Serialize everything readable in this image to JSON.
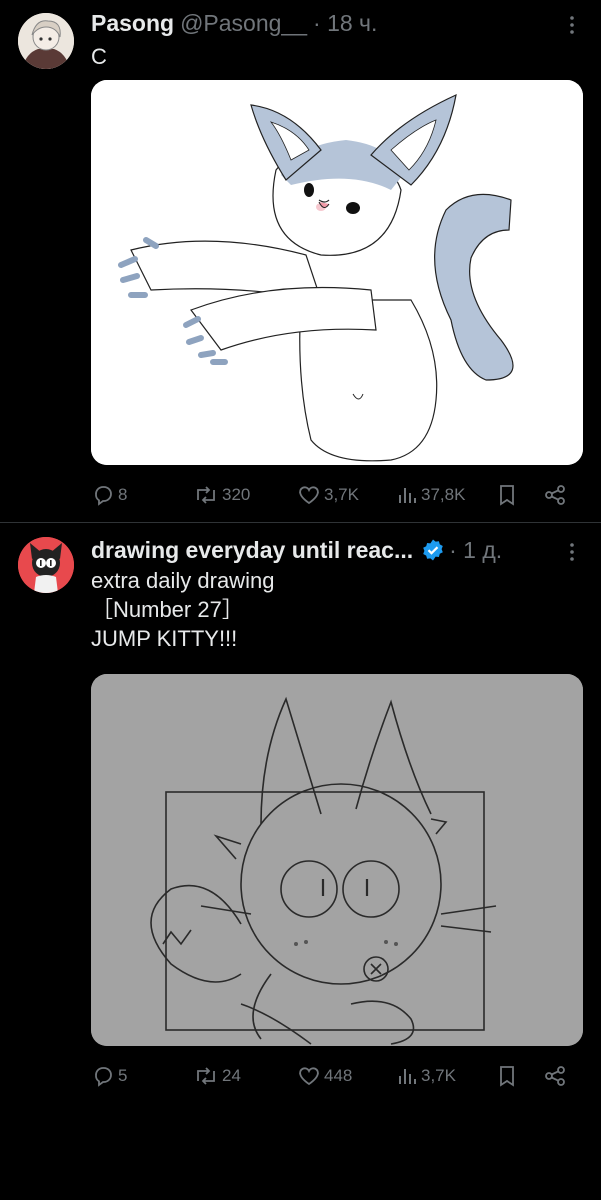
{
  "tweets": [
    {
      "display_name": "Pasong",
      "handle": "@Pasong__",
      "time": "· 18 ч.",
      "text_lines": [
        "С"
      ],
      "actions": {
        "replies": "8",
        "reposts": "320",
        "likes": "3,7K",
        "views": "37,8K"
      }
    },
    {
      "display_name": "drawing everyday until reac...",
      "handle": "",
      "verified": true,
      "time": "· 1 д.",
      "text_lines": [
        "extra daily drawing",
        "［Number 27］",
        "JUMP KITTY!!!"
      ],
      "actions": {
        "replies": "5",
        "reposts": "24",
        "likes": "448",
        "views": "3,7K"
      }
    }
  ],
  "icons": {
    "more": "more-dots-icon",
    "reply": "reply-icon",
    "repost": "repost-icon",
    "like": "heart-icon",
    "views": "views-chart-icon",
    "bookmark": "bookmark-icon",
    "share": "share-icon",
    "verified": "verified-badge-icon"
  },
  "colors": {
    "background": "#000000",
    "text": "#e7e9ea",
    "muted": "#71767b",
    "verified": "#1d9bf0",
    "media2_bg": "#a0a0a0"
  }
}
